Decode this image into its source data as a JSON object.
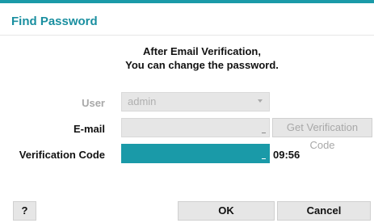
{
  "dialog": {
    "title": "Find Password",
    "message_line1": "After Email Verification,",
    "message_line2": "You can change the password."
  },
  "form": {
    "user_label": "User",
    "user_value": "admin",
    "email_label": "E-mail",
    "email_value": "",
    "get_code_label": "Get Verification Code",
    "code_label": "Verification Code",
    "code_value": "",
    "timer": "09:56"
  },
  "buttons": {
    "help": "?",
    "ok": "OK",
    "cancel": "Cancel"
  },
  "colors": {
    "accent": "#1a9aa8",
    "title": "#1a8fa0",
    "field_bg": "#e6e6e6",
    "disabled_text": "#a8a8a8"
  }
}
